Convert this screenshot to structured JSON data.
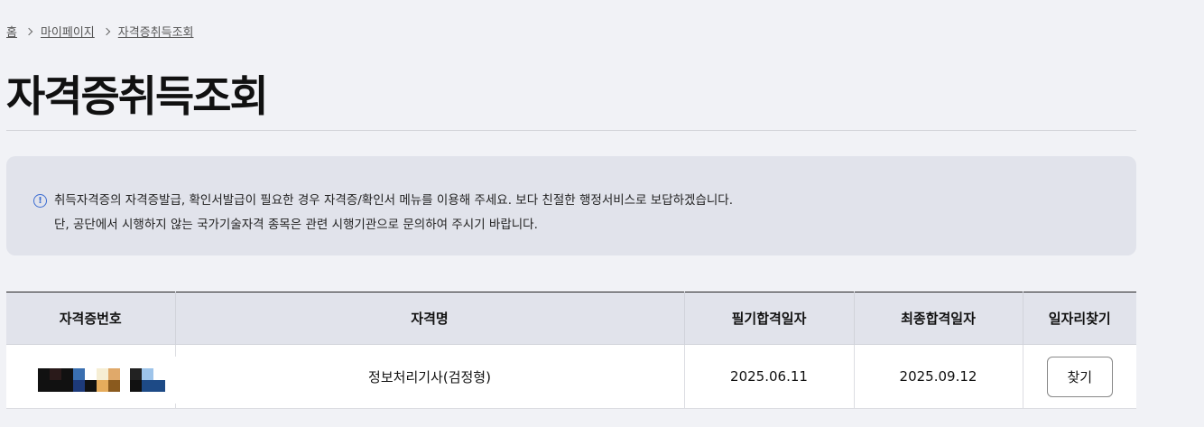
{
  "breadcrumb": {
    "home": "홈",
    "items": [
      "마이페이지",
      "자격증취득조회"
    ]
  },
  "page_title": "자격증취득조회",
  "notice": {
    "icon": "info-icon",
    "line1": "취득자격증의 자격증발급, 확인서발급이 필요한 경우 자격증/확인서 메뉴를 이용해 주세요. 보다 친절한 행정서비스로 보답하겠습니다.",
    "line2": "단, 공단에서 시행하지 않는 국가기술자격 종목은 관련 시행기관으로 문의하여 주시기 바랍니다."
  },
  "table": {
    "headers": [
      "자격증번호",
      "자격명",
      "필기합격일자",
      "최종합격일자",
      "일자리찾기"
    ],
    "rows": [
      {
        "cert_number": "",
        "cert_name": "정보처리기사(검정형)",
        "written_date": "2025.06.11",
        "final_date": "2025.09.12",
        "action_label": "찾기"
      }
    ]
  },
  "colors": {
    "background": "#f1f2f6",
    "notice_bg": "#e1e3eb",
    "info_accent": "#3b6cd1"
  }
}
